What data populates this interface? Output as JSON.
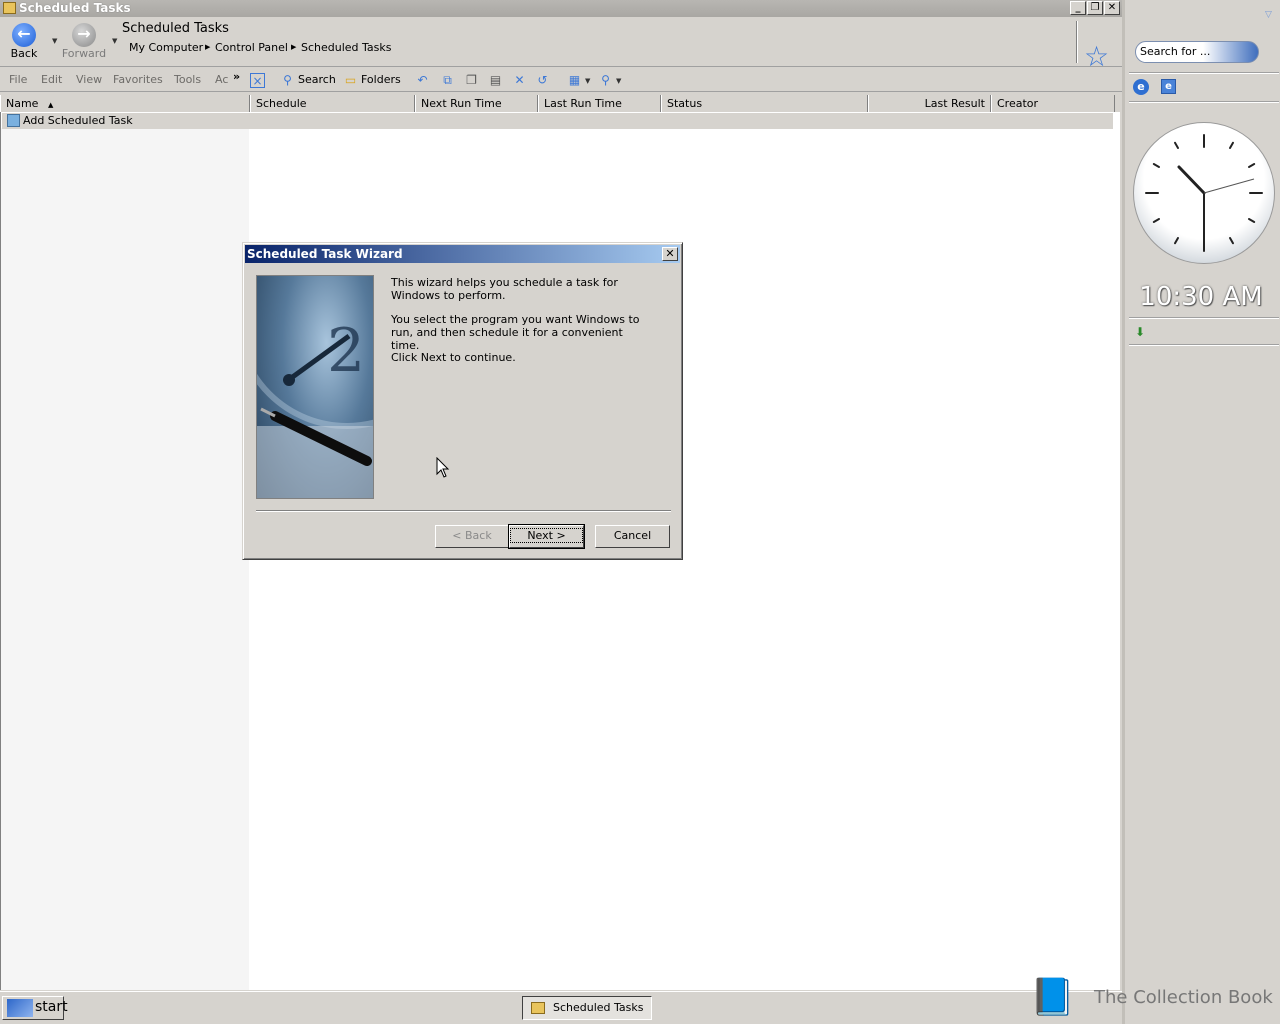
{
  "window": {
    "title": "Scheduled Tasks",
    "btn_min": "_",
    "btn_restore": "❐",
    "btn_close": "✕"
  },
  "nav": {
    "back_label": "Back",
    "forward_label": "Forward",
    "location_title": "Scheduled Tasks",
    "breadcrumbs": [
      "My Computer",
      "Control Panel",
      "Scheduled Tasks"
    ]
  },
  "menus": [
    "File",
    "Edit",
    "View",
    "Favorites",
    "Tools",
    "Ac"
  ],
  "toolbar": {
    "overflow": "»",
    "search_label": "Search",
    "folders_label": "Folders"
  },
  "columns": [
    "Name",
    "Schedule",
    "Next Run Time",
    "Last Run Time",
    "Status",
    "Last Result",
    "Creator"
  ],
  "rows": [
    {
      "name": "Add Scheduled Task"
    }
  ],
  "dialog": {
    "title": "Scheduled Task Wizard",
    "close": "✕",
    "para1": "This wizard helps you schedule a task for Windows to perform.",
    "para2": "You select the program you want Windows to run, and then schedule it for a convenient time.",
    "para3": "Click Next to continue.",
    "back_label": "< Back",
    "next_label": "Next >",
    "cancel_label": "Cancel"
  },
  "sidebar": {
    "search_placeholder": "Search for ...",
    "clock_time": "10:30 AM"
  },
  "taskbar": {
    "start_label": "start",
    "task_label": "Scheduled Tasks"
  },
  "watermark": "The Collection Book",
  "colors": {
    "dialog_title_start": "#0a246a",
    "dialog_title_end": "#a6caf0",
    "chrome": "#d6d3ce"
  }
}
